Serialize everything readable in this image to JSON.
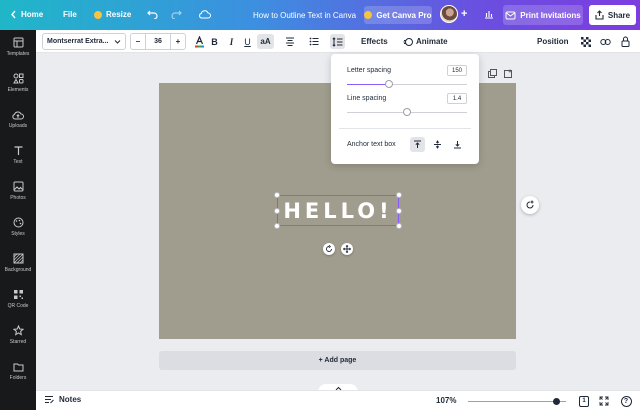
{
  "topbar": {
    "home_label": "Home",
    "file_label": "File",
    "resize_label": "Resize",
    "doc_title": "How to Outline Text in Canva",
    "get_pro_label": "Get Canva Pro",
    "print_label": "Print Invitations",
    "share_label": "Share"
  },
  "sidebar": {
    "items": [
      {
        "label": "Templates",
        "icon": "templates-icon"
      },
      {
        "label": "Elements",
        "icon": "elements-icon"
      },
      {
        "label": "Uploads",
        "icon": "uploads-icon"
      },
      {
        "label": "Text",
        "icon": "text-icon"
      },
      {
        "label": "Photos",
        "icon": "photos-icon"
      },
      {
        "label": "Styles",
        "icon": "styles-icon"
      },
      {
        "label": "Background",
        "icon": "background-icon"
      },
      {
        "label": "QR Code",
        "icon": "qr-code-icon"
      },
      {
        "label": "Starred",
        "icon": "star-icon"
      },
      {
        "label": "Folders",
        "icon": "folder-icon"
      }
    ]
  },
  "toolbar": {
    "font_name": "Montserrat Extra...",
    "font_size": "36",
    "minus": "–",
    "plus": "+",
    "bold": "B",
    "italic": "I",
    "underline": "U",
    "case": "aA",
    "effects_label": "Effects",
    "animate_label": "Animate",
    "position_label": "Position",
    "text_color": "#e53935"
  },
  "spacing_popup": {
    "letter_spacing_label": "Letter spacing",
    "letter_spacing_value": "150",
    "letter_spacing_fraction": 0.35,
    "line_spacing_label": "Line spacing",
    "line_spacing_value": "1.4",
    "line_spacing_fraction": 0.5,
    "anchor_label": "Anchor text box"
  },
  "canvas": {
    "text": "HELLO!",
    "page_color": "#a09d8e",
    "selection_color": "#8b5cf6",
    "add_page_label": "+ Add page"
  },
  "footer": {
    "notes_label": "Notes",
    "zoom_label": "107%",
    "zoom_fraction": 0.9,
    "page_count": "1",
    "help_label": "?"
  }
}
